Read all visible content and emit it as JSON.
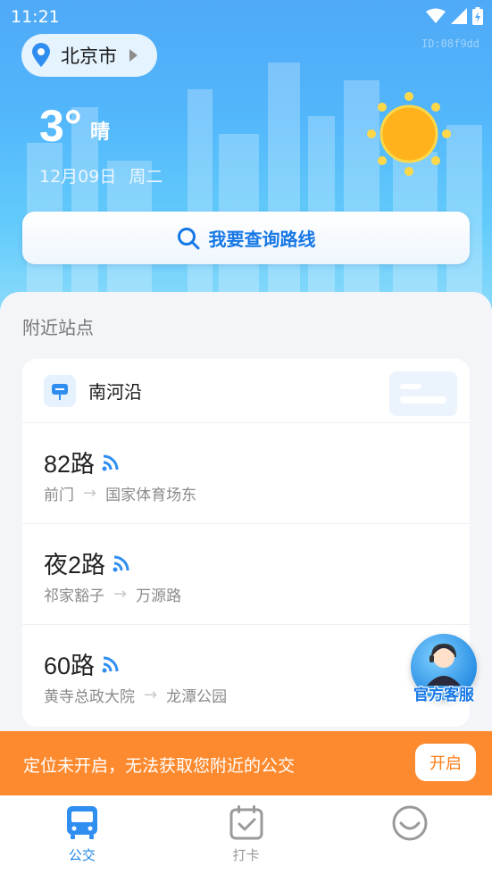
{
  "status_bar": {
    "time": "11:21"
  },
  "watermark": "ID:08f9dd",
  "header": {
    "city": "北京市",
    "temperature": "3°",
    "condition": "晴",
    "date": "12月09日",
    "weekday": "周二",
    "weather_icon": "sun-icon"
  },
  "search": {
    "label": "我要查询路线"
  },
  "nearby": {
    "section_title": "附近站点",
    "stop_name": "南河沿",
    "routes": [
      {
        "name": "82路",
        "from": "前门",
        "to": "国家体育场东"
      },
      {
        "name": "夜2路",
        "from": "祁家豁子",
        "to": "万源路"
      },
      {
        "name": "60路",
        "from": "黄寺总政大院",
        "to": "龙潭公园"
      }
    ]
  },
  "customer_service": {
    "label": "官方客服"
  },
  "location_banner": {
    "message": "定位未开启，无法获取您附近的公交",
    "button": "开启"
  },
  "tabbar": {
    "tabs": [
      {
        "label": "公交",
        "icon": "bus-icon",
        "active": true
      },
      {
        "label": "打卡",
        "icon": "calendar-check-icon",
        "active": false
      },
      {
        "label": "",
        "icon": "check-circle-icon",
        "active": false
      }
    ]
  },
  "colors": {
    "accent": "#1677e6",
    "banner": "#fd8a2e",
    "sun": "#ffb21c"
  }
}
